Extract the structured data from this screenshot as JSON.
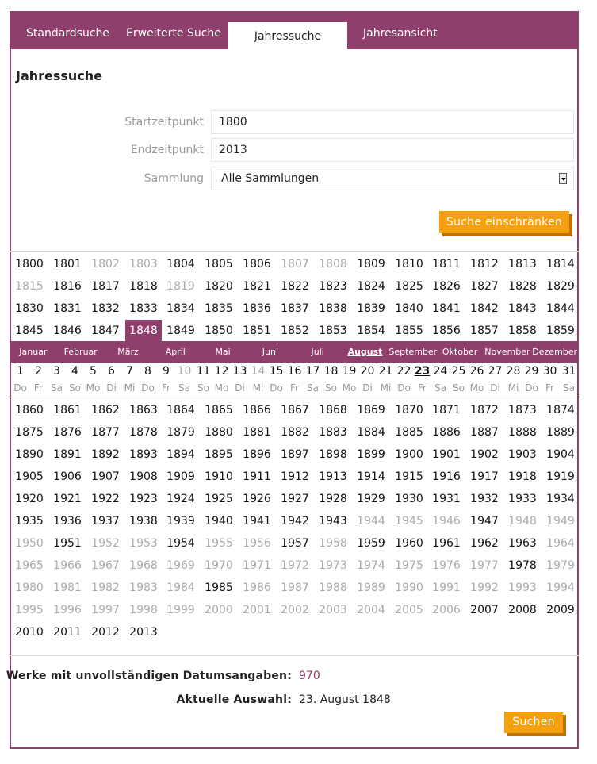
{
  "tabs": [
    {
      "label": "Standardsuche"
    },
    {
      "label": "Erweiterte Suche"
    },
    {
      "label": "Jahressuche"
    },
    {
      "label": "Jahresansicht"
    }
  ],
  "active_tab": "Jahressuche",
  "page_title": "Jahressuche",
  "form": {
    "start_label": "Startzeitpunkt",
    "start_value": "1800",
    "end_label": "Endzeitpunkt",
    "end_value": "2013",
    "collection_label": "Sammlung",
    "collection_value": "Alle Sammlungen",
    "refine_button": "Suche einschränken"
  },
  "years_top": [
    {
      "year": "1800",
      "active": true
    },
    {
      "year": "1801",
      "active": true
    },
    {
      "year": "1802",
      "active": false
    },
    {
      "year": "1803",
      "active": false
    },
    {
      "year": "1804",
      "active": true
    },
    {
      "year": "1805",
      "active": true
    },
    {
      "year": "1806",
      "active": true
    },
    {
      "year": "1807",
      "active": false
    },
    {
      "year": "1808",
      "active": false
    },
    {
      "year": "1809",
      "active": true
    },
    {
      "year": "1810",
      "active": true
    },
    {
      "year": "1811",
      "active": true
    },
    {
      "year": "1812",
      "active": true
    },
    {
      "year": "1813",
      "active": true
    },
    {
      "year": "1814",
      "active": true
    },
    {
      "year": "1815",
      "active": false
    },
    {
      "year": "1816",
      "active": true
    },
    {
      "year": "1817",
      "active": true
    },
    {
      "year": "1818",
      "active": true
    },
    {
      "year": "1819",
      "active": false
    },
    {
      "year": "1820",
      "active": true
    },
    {
      "year": "1821",
      "active": true
    },
    {
      "year": "1822",
      "active": true
    },
    {
      "year": "1823",
      "active": true
    },
    {
      "year": "1824",
      "active": true
    },
    {
      "year": "1825",
      "active": true
    },
    {
      "year": "1826",
      "active": true
    },
    {
      "year": "1827",
      "active": true
    },
    {
      "year": "1828",
      "active": true
    },
    {
      "year": "1829",
      "active": true
    },
    {
      "year": "1830",
      "active": true
    },
    {
      "year": "1831",
      "active": true
    },
    {
      "year": "1832",
      "active": true
    },
    {
      "year": "1833",
      "active": true
    },
    {
      "year": "1834",
      "active": true
    },
    {
      "year": "1835",
      "active": true
    },
    {
      "year": "1836",
      "active": true
    },
    {
      "year": "1837",
      "active": true
    },
    {
      "year": "1838",
      "active": true
    },
    {
      "year": "1839",
      "active": true
    },
    {
      "year": "1840",
      "active": true
    },
    {
      "year": "1841",
      "active": true
    },
    {
      "year": "1842",
      "active": true
    },
    {
      "year": "1843",
      "active": true
    },
    {
      "year": "1844",
      "active": true
    },
    {
      "year": "1845",
      "active": true
    },
    {
      "year": "1846",
      "active": true
    },
    {
      "year": "1847",
      "active": true
    },
    {
      "year": "1848",
      "active": true,
      "selected": true
    },
    {
      "year": "1849",
      "active": true
    },
    {
      "year": "1850",
      "active": true
    },
    {
      "year": "1851",
      "active": true
    },
    {
      "year": "1852",
      "active": true
    },
    {
      "year": "1853",
      "active": true
    },
    {
      "year": "1854",
      "active": true
    },
    {
      "year": "1855",
      "active": true
    },
    {
      "year": "1856",
      "active": true
    },
    {
      "year": "1857",
      "active": true
    },
    {
      "year": "1858",
      "active": true
    },
    {
      "year": "1859",
      "active": true
    }
  ],
  "months": [
    "Januar",
    "Februar",
    "März",
    "April",
    "Mai",
    "Juni",
    "Juli",
    "August",
    "September",
    "Oktober",
    "November",
    "Dezember"
  ],
  "current_month": "August",
  "days": [
    {
      "num": "1",
      "wd": "Do"
    },
    {
      "num": "2",
      "wd": "Fr"
    },
    {
      "num": "3",
      "wd": "Sa"
    },
    {
      "num": "4",
      "wd": "So"
    },
    {
      "num": "5",
      "wd": "Mo"
    },
    {
      "num": "6",
      "wd": "Di"
    },
    {
      "num": "7",
      "wd": "Mi"
    },
    {
      "num": "8",
      "wd": "Do"
    },
    {
      "num": "9",
      "wd": "Fr"
    },
    {
      "num": "10",
      "wd": "Sa",
      "muted": true
    },
    {
      "num": "11",
      "wd": "So"
    },
    {
      "num": "12",
      "wd": "Mo"
    },
    {
      "num": "13",
      "wd": "Di"
    },
    {
      "num": "14",
      "wd": "Mi",
      "muted": true
    },
    {
      "num": "15",
      "wd": "Do"
    },
    {
      "num": "16",
      "wd": "Fr"
    },
    {
      "num": "17",
      "wd": "Sa"
    },
    {
      "num": "18",
      "wd": "So"
    },
    {
      "num": "19",
      "wd": "Mo"
    },
    {
      "num": "20",
      "wd": "Di"
    },
    {
      "num": "21",
      "wd": "Mi"
    },
    {
      "num": "22",
      "wd": "Do"
    },
    {
      "num": "23",
      "wd": "Fr",
      "current": true
    },
    {
      "num": "24",
      "wd": "Sa"
    },
    {
      "num": "25",
      "wd": "So"
    },
    {
      "num": "26",
      "wd": "Mo"
    },
    {
      "num": "27",
      "wd": "Di"
    },
    {
      "num": "28",
      "wd": "Mi"
    },
    {
      "num": "29",
      "wd": "Do"
    },
    {
      "num": "30",
      "wd": "Fr"
    },
    {
      "num": "31",
      "wd": "Sa"
    }
  ],
  "years_bottom": [
    {
      "year": "1860",
      "active": true
    },
    {
      "year": "1861",
      "active": true
    },
    {
      "year": "1862",
      "active": true
    },
    {
      "year": "1863",
      "active": true
    },
    {
      "year": "1864",
      "active": true
    },
    {
      "year": "1865",
      "active": true
    },
    {
      "year": "1866",
      "active": true
    },
    {
      "year": "1867",
      "active": true
    },
    {
      "year": "1868",
      "active": true
    },
    {
      "year": "1869",
      "active": true
    },
    {
      "year": "1870",
      "active": true
    },
    {
      "year": "1871",
      "active": true
    },
    {
      "year": "1872",
      "active": true
    },
    {
      "year": "1873",
      "active": true
    },
    {
      "year": "1874",
      "active": true
    },
    {
      "year": "1875",
      "active": true
    },
    {
      "year": "1876",
      "active": true
    },
    {
      "year": "1877",
      "active": true
    },
    {
      "year": "1878",
      "active": true
    },
    {
      "year": "1879",
      "active": true
    },
    {
      "year": "1880",
      "active": true
    },
    {
      "year": "1881",
      "active": true
    },
    {
      "year": "1882",
      "active": true
    },
    {
      "year": "1883",
      "active": true
    },
    {
      "year": "1884",
      "active": true
    },
    {
      "year": "1885",
      "active": true
    },
    {
      "year": "1886",
      "active": true
    },
    {
      "year": "1887",
      "active": true
    },
    {
      "year": "1888",
      "active": true
    },
    {
      "year": "1889",
      "active": true
    },
    {
      "year": "1890",
      "active": true
    },
    {
      "year": "1891",
      "active": true
    },
    {
      "year": "1892",
      "active": true
    },
    {
      "year": "1893",
      "active": true
    },
    {
      "year": "1894",
      "active": true
    },
    {
      "year": "1895",
      "active": true
    },
    {
      "year": "1896",
      "active": true
    },
    {
      "year": "1897",
      "active": true
    },
    {
      "year": "1898",
      "active": true
    },
    {
      "year": "1899",
      "active": true
    },
    {
      "year": "1900",
      "active": true
    },
    {
      "year": "1901",
      "active": true
    },
    {
      "year": "1902",
      "active": true
    },
    {
      "year": "1903",
      "active": true
    },
    {
      "year": "1904",
      "active": true
    },
    {
      "year": "1905",
      "active": true
    },
    {
      "year": "1906",
      "active": true
    },
    {
      "year": "1907",
      "active": true
    },
    {
      "year": "1908",
      "active": true
    },
    {
      "year": "1909",
      "active": true
    },
    {
      "year": "1910",
      "active": true
    },
    {
      "year": "1911",
      "active": true
    },
    {
      "year": "1912",
      "active": true
    },
    {
      "year": "1913",
      "active": true
    },
    {
      "year": "1914",
      "active": true
    },
    {
      "year": "1915",
      "active": true
    },
    {
      "year": "1916",
      "active": true
    },
    {
      "year": "1917",
      "active": true
    },
    {
      "year": "1918",
      "active": true
    },
    {
      "year": "1919",
      "active": true
    },
    {
      "year": "1920",
      "active": true
    },
    {
      "year": "1921",
      "active": true
    },
    {
      "year": "1922",
      "active": true
    },
    {
      "year": "1923",
      "active": true
    },
    {
      "year": "1924",
      "active": true
    },
    {
      "year": "1925",
      "active": true
    },
    {
      "year": "1926",
      "active": true
    },
    {
      "year": "1927",
      "active": true
    },
    {
      "year": "1928",
      "active": true
    },
    {
      "year": "1929",
      "active": true
    },
    {
      "year": "1930",
      "active": true
    },
    {
      "year": "1931",
      "active": true
    },
    {
      "year": "1932",
      "active": true
    },
    {
      "year": "1933",
      "active": true
    },
    {
      "year": "1934",
      "active": true
    },
    {
      "year": "1935",
      "active": true
    },
    {
      "year": "1936",
      "active": true
    },
    {
      "year": "1937",
      "active": true
    },
    {
      "year": "1938",
      "active": true
    },
    {
      "year": "1939",
      "active": true
    },
    {
      "year": "1940",
      "active": true
    },
    {
      "year": "1941",
      "active": true
    },
    {
      "year": "1942",
      "active": true
    },
    {
      "year": "1943",
      "active": true
    },
    {
      "year": "1944",
      "active": false
    },
    {
      "year": "1945",
      "active": false
    },
    {
      "year": "1946",
      "active": false
    },
    {
      "year": "1947",
      "active": true
    },
    {
      "year": "1948",
      "active": false
    },
    {
      "year": "1949",
      "active": false
    },
    {
      "year": "1950",
      "active": false
    },
    {
      "year": "1951",
      "active": true
    },
    {
      "year": "1952",
      "active": false
    },
    {
      "year": "1953",
      "active": false
    },
    {
      "year": "1954",
      "active": true
    },
    {
      "year": "1955",
      "active": false
    },
    {
      "year": "1956",
      "active": false
    },
    {
      "year": "1957",
      "active": true
    },
    {
      "year": "1958",
      "active": false
    },
    {
      "year": "1959",
      "active": true
    },
    {
      "year": "1960",
      "active": true
    },
    {
      "year": "1961",
      "active": true
    },
    {
      "year": "1962",
      "active": true
    },
    {
      "year": "1963",
      "active": true
    },
    {
      "year": "1964",
      "active": false
    },
    {
      "year": "1965",
      "active": false
    },
    {
      "year": "1966",
      "active": false
    },
    {
      "year": "1967",
      "active": false
    },
    {
      "year": "1968",
      "active": false
    },
    {
      "year": "1969",
      "active": false
    },
    {
      "year": "1970",
      "active": false
    },
    {
      "year": "1971",
      "active": false
    },
    {
      "year": "1972",
      "active": false
    },
    {
      "year": "1973",
      "active": false
    },
    {
      "year": "1974",
      "active": false
    },
    {
      "year": "1975",
      "active": false
    },
    {
      "year": "1976",
      "active": false
    },
    {
      "year": "1977",
      "active": false
    },
    {
      "year": "1978",
      "active": true
    },
    {
      "year": "1979",
      "active": false
    },
    {
      "year": "1980",
      "active": false
    },
    {
      "year": "1981",
      "active": false
    },
    {
      "year": "1982",
      "active": false
    },
    {
      "year": "1983",
      "active": false
    },
    {
      "year": "1984",
      "active": false
    },
    {
      "year": "1985",
      "active": true
    },
    {
      "year": "1986",
      "active": false
    },
    {
      "year": "1987",
      "active": false
    },
    {
      "year": "1988",
      "active": false
    },
    {
      "year": "1989",
      "active": false
    },
    {
      "year": "1990",
      "active": false
    },
    {
      "year": "1991",
      "active": false
    },
    {
      "year": "1992",
      "active": false
    },
    {
      "year": "1993",
      "active": false
    },
    {
      "year": "1994",
      "active": false
    },
    {
      "year": "1995",
      "active": false
    },
    {
      "year": "1996",
      "active": false
    },
    {
      "year": "1997",
      "active": false
    },
    {
      "year": "1998",
      "active": false
    },
    {
      "year": "1999",
      "active": false
    },
    {
      "year": "2000",
      "active": false
    },
    {
      "year": "2001",
      "active": false
    },
    {
      "year": "2002",
      "active": false
    },
    {
      "year": "2003",
      "active": false
    },
    {
      "year": "2004",
      "active": false
    },
    {
      "year": "2005",
      "active": false
    },
    {
      "year": "2006",
      "active": false
    },
    {
      "year": "2007",
      "active": true
    },
    {
      "year": "2008",
      "active": true
    },
    {
      "year": "2009",
      "active": true
    },
    {
      "year": "2010",
      "active": true
    },
    {
      "year": "2011",
      "active": true
    },
    {
      "year": "2012",
      "active": true
    },
    {
      "year": "2013",
      "active": true
    }
  ],
  "summary": {
    "incomplete_label": "Werke mit unvollständigen Datumsangaben:",
    "incomplete_value": "970",
    "current_label": "Aktuelle Auswahl:",
    "current_value": "23. August 1848"
  },
  "search_button": "Suchen",
  "colors": {
    "brand": "#8e3f6b",
    "button": "#f5a00f",
    "button_shadow": "#c07400",
    "inactive_text": "#aaaaaa"
  }
}
